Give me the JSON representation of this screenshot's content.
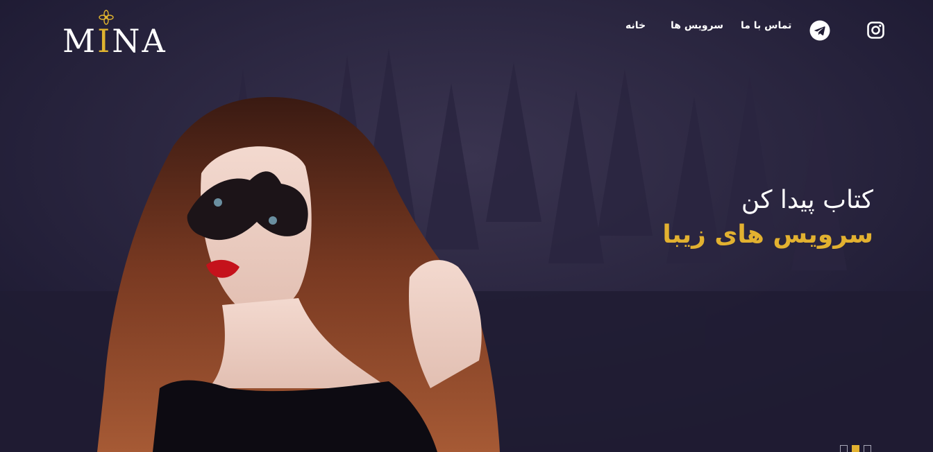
{
  "brand": {
    "logo_text_first": "M",
    "logo_text_accent": "I",
    "logo_text_rest": "NA",
    "accent_color": "#e0b42f"
  },
  "nav": {
    "items": [
      {
        "label": "خانه"
      },
      {
        "label": "سرویس ها"
      },
      {
        "label": "تماس با ما"
      }
    ]
  },
  "social": {
    "telegram_icon": "telegram-icon",
    "instagram_icon": "instagram-icon"
  },
  "hero": {
    "line1": "کتاب پیدا کن",
    "line2": "سرویس های زیبا",
    "line2_color": "#e2b130"
  },
  "slider": {
    "count": 3,
    "active_index": 1
  },
  "colors": {
    "background": "#211d35",
    "text": "#ffffff",
    "gold": "#e2b130"
  }
}
